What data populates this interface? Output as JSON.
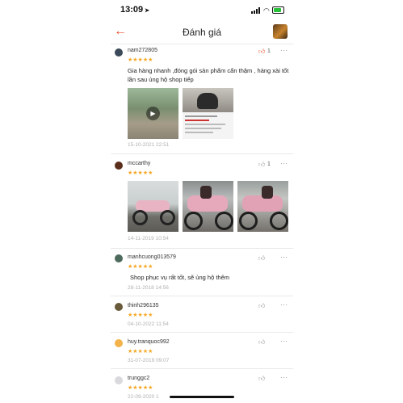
{
  "status": {
    "time": "13:09",
    "location_icon": "location-arrow-icon",
    "battery_color": "#27c13a"
  },
  "header": {
    "back_icon": "back-arrow-icon",
    "title": "Đánh giá"
  },
  "accent_color": "#ee4d2d",
  "star_color": "#f5a623",
  "reviews": [
    {
      "username": "nam272805",
      "stars": "★★★★★",
      "likes": "1",
      "liked": true,
      "comment": "Gia hàng nhanh ,đóng gói sản phẩm cẩn thậm , hàng xài tốt lần sau ủng hộ shop tiếp",
      "date": "15-10-2021 22:51",
      "media": [
        "video",
        "screenshot"
      ]
    },
    {
      "username": "mccarthy",
      "stars": "★★★★★",
      "likes": "1",
      "liked": false,
      "comment": "",
      "date": "14-11-2019 10:54",
      "media": [
        "photo",
        "photo",
        "photo"
      ]
    },
    {
      "username": "manhcuong013579",
      "stars": "★★★★★",
      "likes": "",
      "liked": false,
      "comment": "Shop phục vụ rất tốt, sẽ ủng hộ thêm",
      "date": "28-11-2018 14:56",
      "media": []
    },
    {
      "username": "thinh296135",
      "stars": "★★★★★",
      "likes": "",
      "liked": false,
      "comment": "",
      "date": "04-10-2022 11:54",
      "media": []
    },
    {
      "username": "huy.tranquoc992",
      "stars": "★★★★★",
      "likes": "",
      "liked": false,
      "comment": "",
      "date": "31-07-2019 09:07",
      "media": []
    },
    {
      "username": "trunggc2",
      "stars": "★★★★★",
      "likes": "",
      "liked": false,
      "comment": "",
      "date": "22-09-2020 1",
      "media": []
    }
  ],
  "icons": {
    "like": "thumbs-up-icon",
    "more": "more-dots-icon",
    "play": "play-icon"
  }
}
